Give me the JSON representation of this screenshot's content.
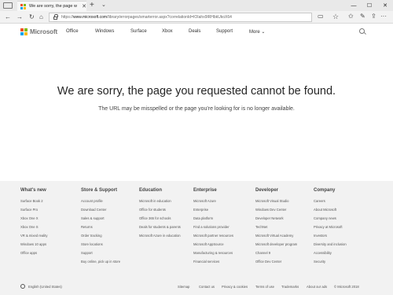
{
  "browser": {
    "tab_title": "We are sorry, the page w",
    "tab_close": "✕",
    "new_tab": "+",
    "tab_list": "⌄",
    "window_controls": {
      "minimize": "—",
      "maximize": "☐",
      "close": "✕"
    },
    "url_prefix": "https://",
    "url_host": "www.microsoft.com",
    "url_rest": "/library/errorpages/smarterror.aspx?correlationId=IOIahx9lRHbkUkoX64",
    "icons": {
      "back": "←",
      "forward": "→",
      "refresh": "↻",
      "home": "⌂",
      "reader": "▭",
      "favorite": "☆",
      "favorites_bar": "✩",
      "notes": "✎",
      "share": "⇪",
      "more": "···"
    }
  },
  "header": {
    "logo_text": "Microsoft",
    "logo_colors": [
      "#f25022",
      "#7fba00",
      "#00a4ef",
      "#ffb900"
    ],
    "nav": [
      "Office",
      "Windows",
      "Surface",
      "Xbox",
      "Deals",
      "Support",
      "More ⌄"
    ]
  },
  "main": {
    "title": "We are sorry, the page you requested cannot be found.",
    "subtitle": "The URL may be misspelled or the page you're looking for is no longer available."
  },
  "footer": {
    "columns": [
      {
        "heading": "What's new",
        "links": [
          "Surface Book 2",
          "Surface Pro",
          "Xbox One X",
          "Xbox One S",
          "VR & mixed reality",
          "Windows 10 apps",
          "Office apps"
        ]
      },
      {
        "heading": "Store & Support",
        "links": [
          "Account profile",
          "Download Center",
          "Sales & support",
          "Returns",
          "Order tracking",
          "Store locations",
          "Support",
          "Buy online, pick up in store"
        ]
      },
      {
        "heading": "Education",
        "links": [
          "Microsoft in education",
          "Office for students",
          "Office 365 for schools",
          "Deals for students & parents",
          "Microsoft Azure in education"
        ]
      },
      {
        "heading": "Enterprise",
        "links": [
          "Microsoft Azure",
          "Enterprise",
          "Data platform",
          "Find a solutions provider",
          "Microsoft partner resources",
          "Microsoft AppSource",
          "Manufacturing & resources",
          "Financial services"
        ]
      },
      {
        "heading": "Developer",
        "links": [
          "Microsoft Visual Studio",
          "Windows Dev Center",
          "Developer Network",
          "TechNet",
          "Microsoft Virtual Academy",
          "Microsoft developer program",
          "Channel 9",
          "Office Dev Center"
        ]
      },
      {
        "heading": "Company",
        "links": [
          "Careers",
          "About Microsoft",
          "Company news",
          "Privacy at Microsoft",
          "Investors",
          "Diversity and inclusion",
          "Accessibility",
          "Security"
        ]
      }
    ],
    "locale": "English (United States)",
    "legal_links": [
      "Sitemap",
      "Contact us",
      "Privacy & cookies",
      "Terms of use",
      "Trademarks",
      "About our ads",
      "© Microsoft 2018"
    ]
  }
}
